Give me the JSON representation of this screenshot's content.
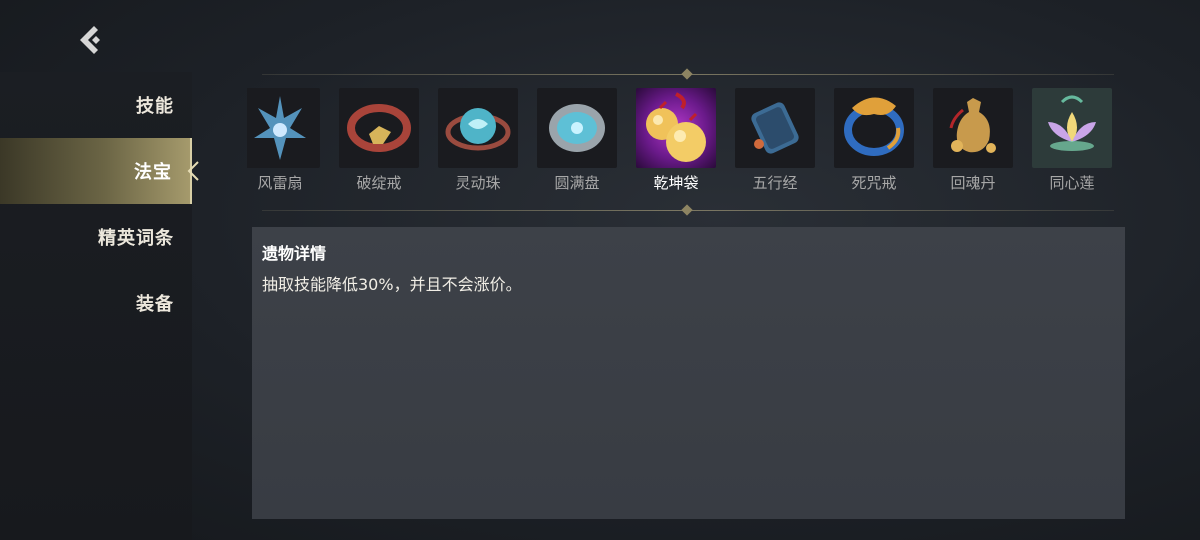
{
  "nav": {
    "back_icon": "chevron-left-icon"
  },
  "sidebar": {
    "items": [
      {
        "label": "技能",
        "active": false
      },
      {
        "label": "法宝",
        "active": true
      },
      {
        "label": "精英词条",
        "active": false
      },
      {
        "label": "装备",
        "active": false
      }
    ]
  },
  "relics": {
    "items": [
      {
        "name": "风雷扇",
        "icon": "fan-icon",
        "visible_name": "风雷扇"
      },
      {
        "name": "破绽戒",
        "icon": "ring-icon"
      },
      {
        "name": "灵动珠",
        "icon": "orb-icon"
      },
      {
        "name": "圆满盘",
        "icon": "disc-icon"
      },
      {
        "name": "乾坤袋",
        "icon": "gourd-bag-icon",
        "selected": true
      },
      {
        "name": "五行经",
        "icon": "scroll-icon"
      },
      {
        "name": "死咒戒",
        "icon": "cursed-ring-icon"
      },
      {
        "name": "回魂丹",
        "icon": "elixir-jar-icon"
      },
      {
        "name": "同心莲",
        "icon": "lotus-icon"
      }
    ]
  },
  "detail": {
    "title": "遗物详情",
    "description": "抽取技能降低30%，并且不会涨价。"
  },
  "colors": {
    "accent_gold": "#a59a6c",
    "selected_glow": "#b238c9",
    "panel_bg": "#3b3f46"
  }
}
